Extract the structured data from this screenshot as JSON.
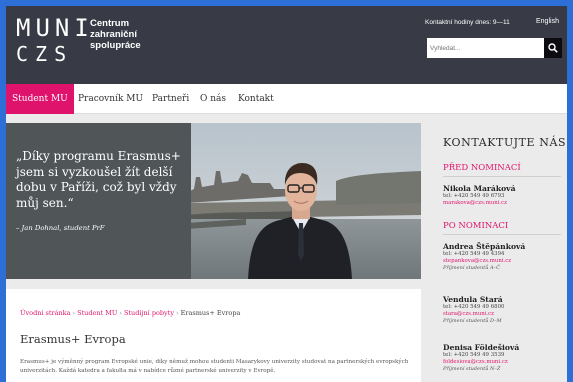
{
  "header": {
    "logo": {
      "line1": "MUNI",
      "line2": "CZS",
      "text": [
        "Centrum",
        "zahraniční",
        "spolupráce"
      ]
    },
    "hours": "Kontaktní hodiny dnes: 9—11",
    "language": "English",
    "search": {
      "placeholder": "Vyhledat..."
    }
  },
  "nav": {
    "items": [
      "Student MU",
      "Pracovník MU",
      "Partneři",
      "O nás",
      "Kontakt"
    ],
    "active": "Student MU"
  },
  "hero": {
    "quote": "„Díky programu Erasmus+ jsem si vyzkoušel žít delší dobu v Paříži, což byl vždy můj sen.“",
    "author": "– Jan Dohnal, student PrF"
  },
  "breadcrumb": [
    "Úvodní stránka",
    "Student MU",
    "Studijní pobyty",
    "Erasmus+ Evropa"
  ],
  "page_title": "Erasmus+ Evropa",
  "intro": "Erasmus+ je výměnný program Evropské unie, díky němuž mohou studenti Masarykovy univerzity studovat na partnerských evropských univerzitách. Každá katedra a fakulta má v nabídce různé partnerské univerzity v Evropě.",
  "sidebar": {
    "title": "KONTAKTUJTE NÁS",
    "before_nomination": "PŘED NOMINACÍ",
    "after_nomination": "PO NOMINACI",
    "contacts_before": [
      {
        "name": "Nikola Maráková",
        "tel": "tel: +420 549 49 6793",
        "email": "marakova@czs.muni.cz"
      }
    ],
    "contacts_after": [
      {
        "name": "Andrea Štěpánková",
        "tel": "tel: +420 549 49 4394",
        "email": "stepankova@czs.muni.cz",
        "note": "Příjmení studentů A–Č"
      },
      {
        "name": "Vendula Stará",
        "tel": "tel: +420 549 49 6800",
        "email": "stara@czs.muni.cz",
        "note": "Příjmení studentů D–M"
      },
      {
        "name": "Denisa Földešiová",
        "tel": "tel: +420 549 49 3539",
        "email": "foldesiova@czs.muni.cz",
        "note": "Příjmení studentů N–Ž"
      }
    ]
  },
  "colors": {
    "accent": "#e0136c",
    "header_bg": "#383b46",
    "page_border": "#2d6fd6"
  }
}
